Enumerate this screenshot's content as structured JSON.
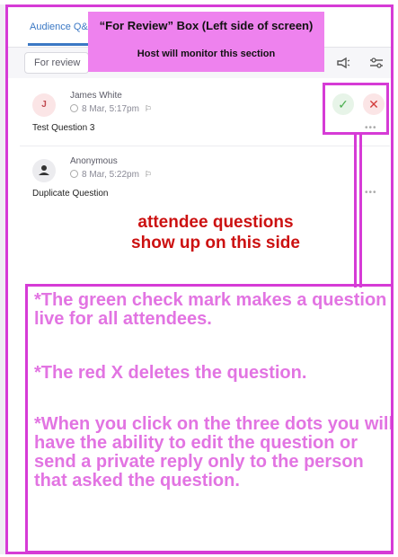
{
  "header": {
    "tab_label": "Audience Q&A"
  },
  "filter": {
    "label": "For review"
  },
  "icons": {
    "megaphone": "megaphone-icon",
    "settings": "sliders-icon",
    "check": "check-icon",
    "delete": "close-icon",
    "more": "more-dots-icon",
    "flag": "flag-icon",
    "clock": "clock-icon"
  },
  "questions": [
    {
      "avatar": "J",
      "name": "James White",
      "time": "8 Mar, 5:17pm",
      "text": "Test Question 3"
    },
    {
      "avatar": "",
      "name": "Anonymous",
      "time": "8 Mar, 5:22pm",
      "text": "Duplicate Question"
    }
  ],
  "annotations": {
    "top_title": "“For Review” Box (Left side of screen)",
    "top_subtitle": "Host will monitor this section",
    "red_line1": "attendee questions",
    "red_line2": "show up on this side",
    "note1": "*The green check mark makes a question live for all attendees.",
    "note2": "*The red X deletes the question.",
    "note3": "*When you click on the three dots you will have the ability to edit the question or send a private reply only to the person that asked the question."
  },
  "colors": {
    "annotation": "#d63bd6",
    "accent": "#3b78c4",
    "red_note": "#cc1111",
    "check": "#4caf50",
    "delete": "#d23b3b"
  }
}
